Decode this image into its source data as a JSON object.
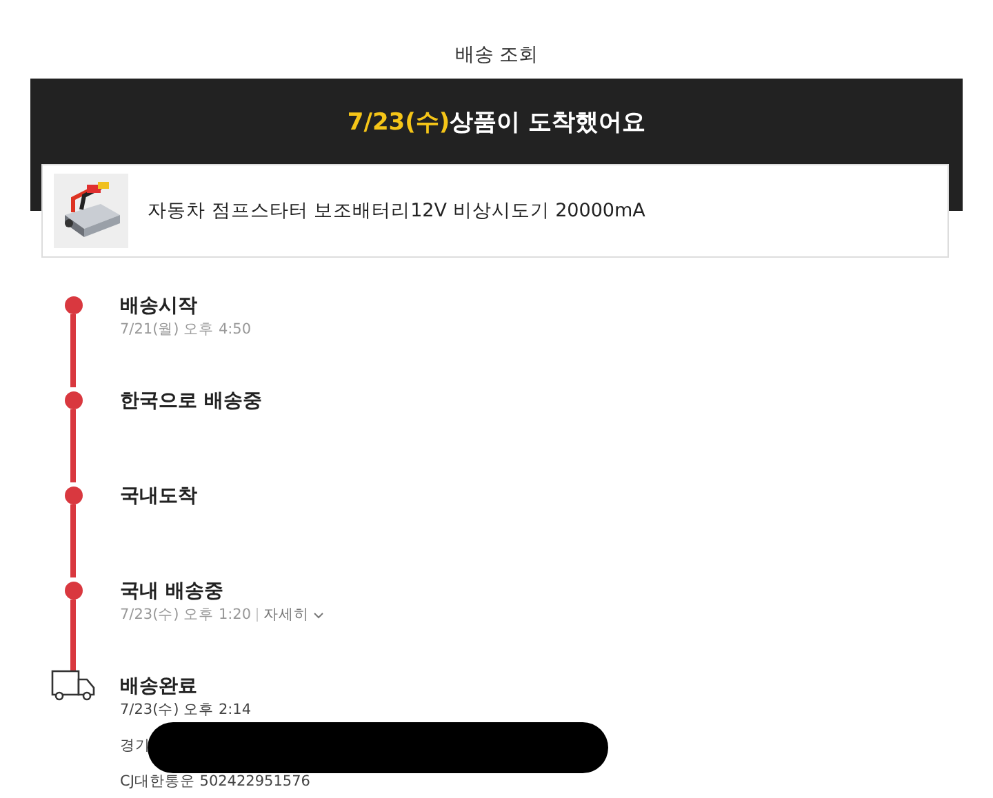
{
  "header": {
    "title": "배송 조회"
  },
  "banner": {
    "date": "7/23(수)",
    "message": "상품이 도착했어요"
  },
  "product": {
    "kind": "picture",
    "name": "자동차 점프스타터 보조배터리12V 비상시도기 20000mA"
  },
  "steps": [
    {
      "kind": "dot",
      "title": "배송시작",
      "time": "7/21(월) 오후 4:50"
    },
    {
      "kind": "dot",
      "title": "한국으로 배송중"
    },
    {
      "kind": "dot",
      "title": "국내도착"
    },
    {
      "kind": "dot",
      "title": "국내 배송중",
      "time": "7/23(수) 오후 1:20",
      "detail": "자세히"
    },
    {
      "kind": "truck",
      "title": "배송완료",
      "time": "7/23(수) 오후 2:14",
      "address": "경기",
      "carrier": "CJ대한통운 502422951576"
    }
  ]
}
